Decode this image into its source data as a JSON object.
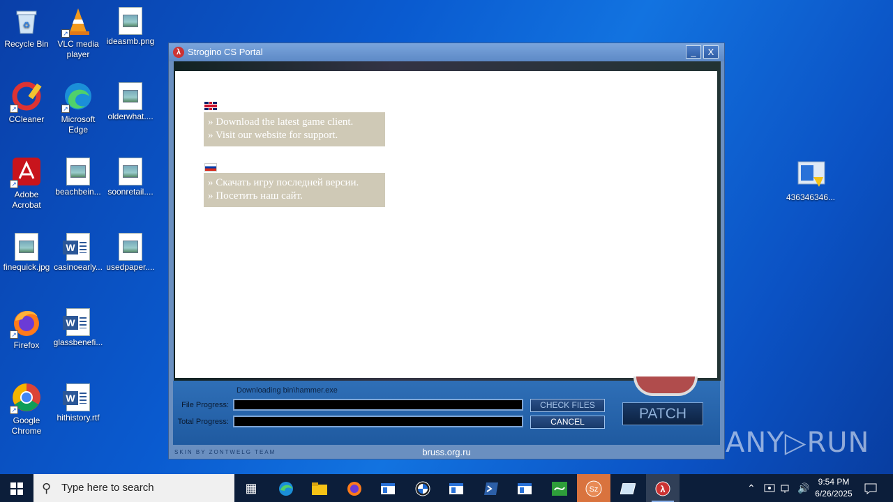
{
  "desktop": {
    "icons": [
      {
        "label": "Recycle Bin"
      },
      {
        "label": "VLC media player"
      },
      {
        "label": "ideasmb.png"
      },
      {
        "label": "CCleaner"
      },
      {
        "label": "Microsoft Edge"
      },
      {
        "label": "olderwhat...."
      },
      {
        "label": "Adobe Acrobat"
      },
      {
        "label": "beachbein..."
      },
      {
        "label": "soonretail...."
      },
      {
        "label": "finequick.jpg"
      },
      {
        "label": "casinoearly..."
      },
      {
        "label": "usedpaper...."
      },
      {
        "label": "Firefox"
      },
      {
        "label": "glassbenefi..."
      },
      {
        "label": "Google Chrome"
      },
      {
        "label": "hithistory.rtf"
      },
      {
        "label": "4363463​46..."
      }
    ]
  },
  "window": {
    "title": "Strogino CS Portal",
    "minimize": "_",
    "close": "X",
    "en_links": [
      "» Download the latest game client.",
      "» Visit our website for support."
    ],
    "ru_links": [
      "» Скачать игру последней версии.",
      "» Посетить наш сайт."
    ],
    "status": "Downloading bin\\hammer.exe",
    "file_progress_label": "File Progress:",
    "total_progress_label": "Total Progress:",
    "check_files": "CHECK FILES",
    "cancel": "CANCEL",
    "patch": "PATCH",
    "credit": "skin by zontwelg team",
    "site": "bruss.org.ru"
  },
  "watermark": "ANY▷RUN",
  "taskbar": {
    "search_placeholder": "Type here to search",
    "time": "9:54 PM",
    "date": "6/26/2025"
  }
}
